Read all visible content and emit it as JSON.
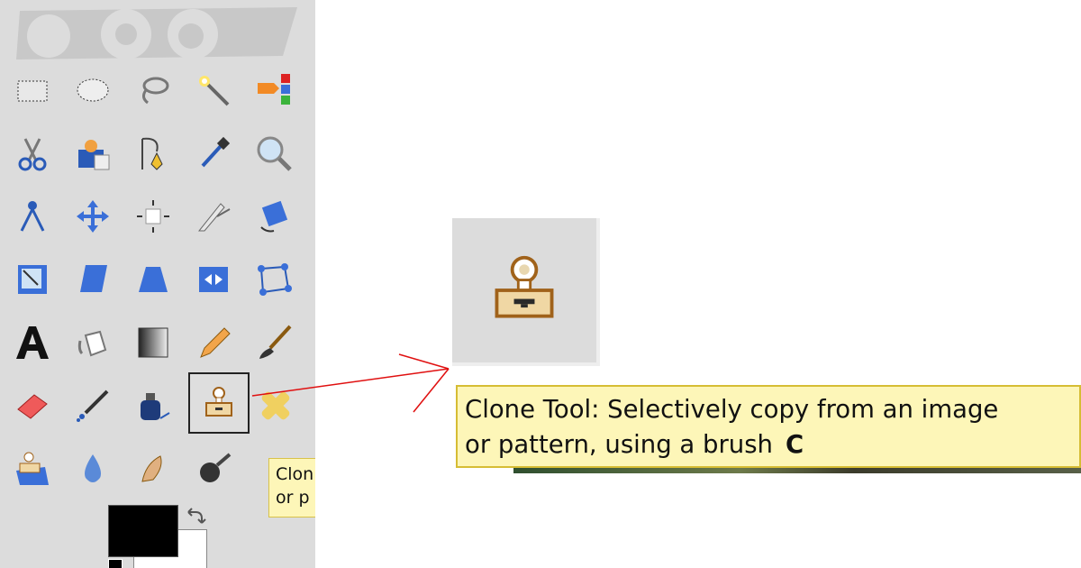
{
  "toolbox": {
    "tools": [
      {
        "name": "Rectangle Select",
        "icon": "rect-select-icon"
      },
      {
        "name": "Ellipse Select",
        "icon": "ellipse-select-icon"
      },
      {
        "name": "Free Select",
        "icon": "lasso-icon"
      },
      {
        "name": "Fuzzy Select",
        "icon": "magic-wand-icon"
      },
      {
        "name": "Select by Color",
        "icon": "color-select-icon"
      },
      {
        "name": "Scissors Select",
        "icon": "scissors-icon"
      },
      {
        "name": "Foreground Select",
        "icon": "foreground-select-icon"
      },
      {
        "name": "Paths",
        "icon": "paths-icon"
      },
      {
        "name": "Color Picker",
        "icon": "color-picker-icon"
      },
      {
        "name": "Zoom",
        "icon": "magnifier-icon"
      },
      {
        "name": "Measure",
        "icon": "compass-icon"
      },
      {
        "name": "Move",
        "icon": "move-icon"
      },
      {
        "name": "Alignment",
        "icon": "align-icon"
      },
      {
        "name": "Crop",
        "icon": "crop-knife-icon"
      },
      {
        "name": "Rotate",
        "icon": "rotate-icon"
      },
      {
        "name": "Scale",
        "icon": "scale-icon"
      },
      {
        "name": "Shear",
        "icon": "shear-icon"
      },
      {
        "name": "Perspective",
        "icon": "perspective-icon"
      },
      {
        "name": "Flip",
        "icon": "flip-icon"
      },
      {
        "name": "Cage Transform",
        "icon": "cage-icon"
      },
      {
        "name": "Text",
        "icon": "text-icon"
      },
      {
        "name": "Bucket Fill",
        "icon": "bucket-icon"
      },
      {
        "name": "Blend",
        "icon": "gradient-icon"
      },
      {
        "name": "Pencil",
        "icon": "pencil-icon"
      },
      {
        "name": "Paintbrush",
        "icon": "paintbrush-icon"
      },
      {
        "name": "Eraser",
        "icon": "eraser-icon"
      },
      {
        "name": "Airbrush",
        "icon": "airbrush-icon"
      },
      {
        "name": "Ink",
        "icon": "ink-icon"
      },
      {
        "name": "Clone",
        "icon": "clone-stamp-icon",
        "active": true
      },
      {
        "name": "Heal",
        "icon": "heal-bandage-icon"
      },
      {
        "name": "Perspective Clone",
        "icon": "perspective-clone-icon"
      },
      {
        "name": "Blur / Sharpen",
        "icon": "water-drop-icon"
      },
      {
        "name": "Smudge",
        "icon": "smudge-icon"
      },
      {
        "name": "Dodge / Burn",
        "icon": "dodge-burn-icon"
      }
    ],
    "mini_tooltip": {
      "line1": "Clon",
      "line2": "or p"
    },
    "colors": {
      "foreground": "#000000",
      "background": "#ffffff"
    }
  },
  "tooltip": {
    "line1": "Clone Tool: Selectively copy from an image",
    "line2": "or pattern, using a brush",
    "shortcut": "C",
    "background": "#fdf6b8"
  },
  "arrow_color": "#e01010"
}
